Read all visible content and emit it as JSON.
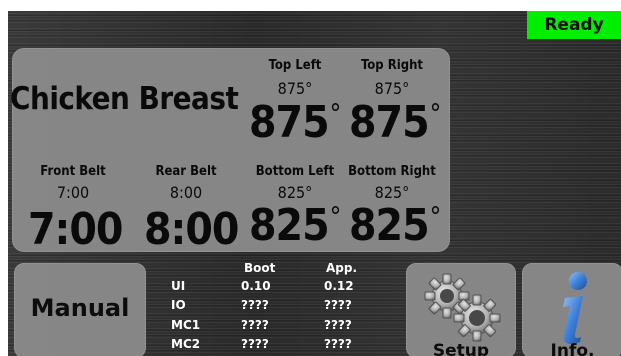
{
  "status": {
    "label": "Ready",
    "color": "#00ee00"
  },
  "recipe": {
    "name": "Chicken Breast"
  },
  "zones": {
    "top_left": {
      "label": "Top Left",
      "setpoint": "875°",
      "actual": "875"
    },
    "top_right": {
      "label": "Top Right",
      "setpoint": "875°",
      "actual": "875"
    },
    "bottom_left": {
      "label": "Bottom Left",
      "setpoint": "825°",
      "actual": "825"
    },
    "bottom_right": {
      "label": "Bottom Right",
      "setpoint": "825°",
      "actual": "825"
    }
  },
  "belts": {
    "front": {
      "label": "Front Belt",
      "setpoint": "7:00",
      "actual": "7:00"
    },
    "rear": {
      "label": "Rear Belt",
      "setpoint": "8:00",
      "actual": "8:00"
    }
  },
  "degree_symbol": "°",
  "buttons": {
    "manual": "Manual",
    "setup": "Setup",
    "info": "Info."
  },
  "icons": {
    "setup": "gears-icon",
    "info": "info-icon"
  },
  "versions": {
    "headers": [
      "Boot",
      "App."
    ],
    "rows": [
      {
        "name": "UI",
        "boot": "0.10",
        "app": "0.12"
      },
      {
        "name": "IO",
        "boot": "????",
        "app": "????"
      },
      {
        "name": "MC1",
        "boot": "????",
        "app": "????"
      },
      {
        "name": "MC2",
        "boot": "????",
        "app": "????"
      }
    ]
  }
}
